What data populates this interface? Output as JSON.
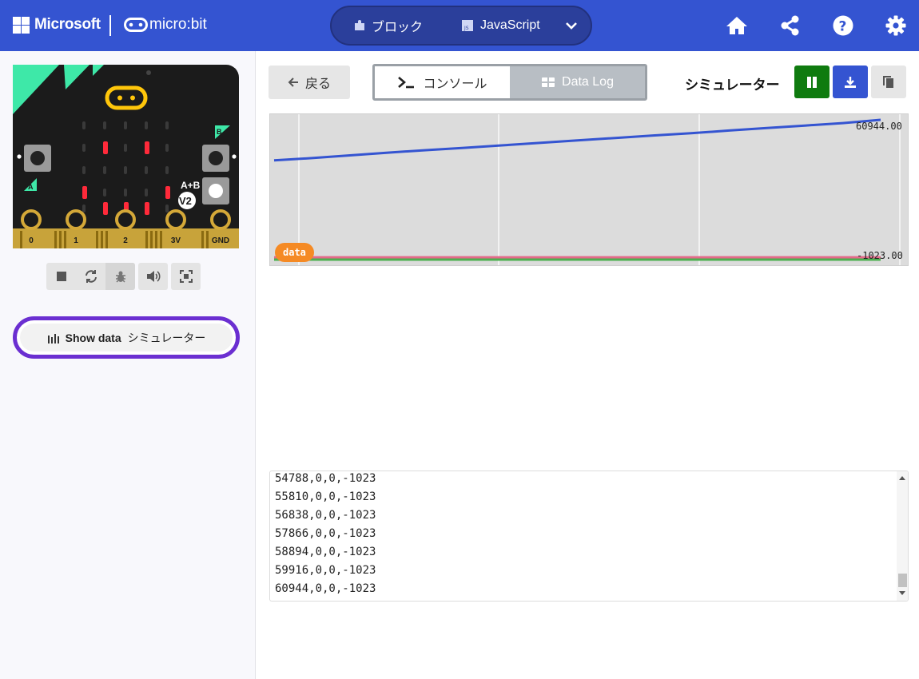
{
  "header": {
    "brand": "Microsoft",
    "product": "micro:bit",
    "modes": {
      "blocks": "ブロック",
      "javascript": "JavaScript"
    },
    "icons": [
      "home-icon",
      "share-icon",
      "help-icon",
      "settings-icon"
    ],
    "color": "#3454D1"
  },
  "simulator": {
    "board": {
      "pins": [
        "0",
        "1",
        "2",
        "3V",
        "GND"
      ],
      "button_a": "A",
      "button_b": "B",
      "button_ab": "A+B",
      "version": "V2",
      "led_matrix": [
        [
          0,
          0,
          0,
          0,
          0
        ],
        [
          0,
          1,
          0,
          1,
          0
        ],
        [
          0,
          0,
          0,
          0,
          0
        ],
        [
          1,
          0,
          0,
          0,
          1
        ],
        [
          0,
          1,
          1,
          1,
          0
        ]
      ]
    },
    "toolbar": [
      "stop-icon",
      "restart-icon",
      "debug-icon",
      "sound-icon",
      "fullscreen-icon"
    ],
    "show_data": {
      "label": "Show data",
      "target": "シミュレーター"
    }
  },
  "dataview": {
    "back_label": "戻る",
    "tabs": {
      "console": "コンソール",
      "data_log": "Data Log"
    },
    "source_label": "シミュレーター",
    "actions": [
      "pause-icon",
      "download-icon",
      "copy-icon"
    ]
  },
  "chart_data": {
    "type": "line",
    "title": "",
    "series_chip": "data",
    "max_label": "60944.00",
    "min_label": "-1023.00",
    "ylim": [
      -1023,
      60944
    ],
    "series": [
      {
        "color": "#3454D1",
        "values": [
          43000,
          44000,
          45200,
          46400,
          47500,
          48500,
          49600,
          50700,
          51800,
          52900,
          54000,
          55000,
          56200,
          57300,
          58400,
          59500,
          60944
        ]
      },
      {
        "color": "#e36a8a",
        "values": [
          0,
          0,
          0,
          0,
          0,
          0,
          0,
          0,
          0,
          0,
          0,
          0,
          0,
          0,
          0,
          0,
          0
        ]
      },
      {
        "color": "#4caf50",
        "values": [
          -1023,
          -1023,
          -1023,
          -1023,
          -1023,
          -1023,
          -1023,
          -1023,
          -1023,
          -1023,
          -1023,
          -1023,
          -1023,
          -1023,
          -1023,
          -1023,
          -1023
        ]
      }
    ]
  },
  "console": {
    "lines": [
      "54788,0,0,-1023",
      "55810,0,0,-1023",
      "56838,0,0,-1023",
      "57866,0,0,-1023",
      "58894,0,0,-1023",
      "59916,0,0,-1023",
      "60944,0,0,-1023"
    ]
  }
}
